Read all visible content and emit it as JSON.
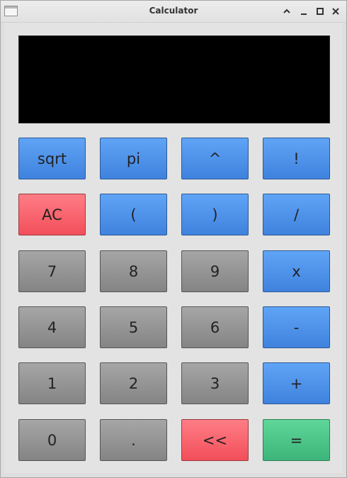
{
  "window": {
    "title": "Calculator"
  },
  "display": {
    "value": ""
  },
  "buttons": [
    [
      {
        "label": "sqrt",
        "style": "blue"
      },
      {
        "label": "pi",
        "style": "blue"
      },
      {
        "label": "^",
        "style": "blue"
      },
      {
        "label": "!",
        "style": "blue"
      }
    ],
    [
      {
        "label": "AC",
        "style": "red"
      },
      {
        "label": "(",
        "style": "blue"
      },
      {
        "label": ")",
        "style": "blue"
      },
      {
        "label": "/",
        "style": "blue"
      }
    ],
    [
      {
        "label": "7",
        "style": "gray"
      },
      {
        "label": "8",
        "style": "gray"
      },
      {
        "label": "9",
        "style": "gray"
      },
      {
        "label": "x",
        "style": "blue"
      }
    ],
    [
      {
        "label": "4",
        "style": "gray"
      },
      {
        "label": "5",
        "style": "gray"
      },
      {
        "label": "6",
        "style": "gray"
      },
      {
        "label": "-",
        "style": "blue"
      }
    ],
    [
      {
        "label": "1",
        "style": "gray"
      },
      {
        "label": "2",
        "style": "gray"
      },
      {
        "label": "3",
        "style": "gray"
      },
      {
        "label": "+",
        "style": "blue"
      }
    ],
    [
      {
        "label": "0",
        "style": "gray"
      },
      {
        "label": ".",
        "style": "gray"
      },
      {
        "label": "<<",
        "style": "red"
      },
      {
        "label": "=",
        "style": "green"
      }
    ]
  ],
  "colors": {
    "blue": "#4a8de8",
    "gray": "#959595",
    "red": "#f9636d",
    "green": "#4ac789",
    "display_background": "#000000"
  },
  "icons": {
    "titlebar": [
      "window-app-icon",
      "shade-icon",
      "minimize-icon",
      "maximize-icon",
      "close-icon"
    ]
  }
}
